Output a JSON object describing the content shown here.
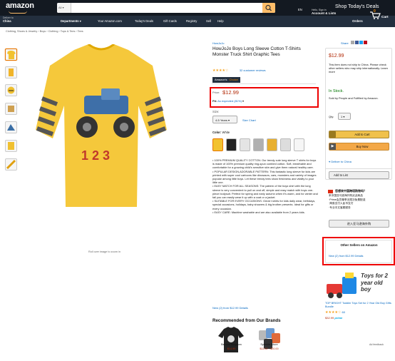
{
  "header": {
    "logo": "amazon",
    "search_category": "All",
    "promo": "Shop Today's Deals",
    "deliver_line1": "Deliver to",
    "deliver_line2": "China",
    "lang": "EN",
    "hello": "Hello, Sign in",
    "account": "Account & Lists",
    "orders": "Orders",
    "cart_count": "0",
    "cart": "Cart"
  },
  "nav": {
    "departments": "Departments",
    "items": [
      "Your Amazon.com",
      "Today's Deals",
      "Gift Cards",
      "Registry",
      "Sell",
      "Help"
    ]
  },
  "breadcrumb": "Clothing, Shoes & Jewelry › Boys › Clothing › Tops & Tees › Tees",
  "image": {
    "caption": "Roll over image to zoom in"
  },
  "product": {
    "brand": "HowJoJo",
    "title": "HowJoJo Boys Long Sleeve Cotton T-Shirts Monster Truck Shirt Graphic Tees",
    "reviews": "32 customer reviews",
    "badge_a": "Amazon's",
    "badge_b": "Choice",
    "price_label": "Price:",
    "price": "$12.99",
    "fit_label": "Fit:",
    "fit_value": "As expected (81%)",
    "size_label": "Size:",
    "size_value": "4-5 Years",
    "size_chart": "Size Chart",
    "color_label": "Color:",
    "color_value": "White",
    "bullets": [
      "100% PREMIUM QUALITY COTTON: Our trendy cute long sleeve T shirts for boys is made of 100% premium quality ring-spun combed cotton. Soft, breathable and comfortable for a growing child's sensitive skin and give them natural healthy care.",
      "POPULAR DESIGN,ADORABLE PATTERN: This fantastic long sleeve for kids are printed with super cool cartoons like dinosaurs, cars, monsters and variety of images popular among little boys. Let these trendy tees show freshness and vitality to your little one.",
      "EASY MATCH FOR ALL SEASONS: The pattern of the boys shirt with the long sleeve is very convenient to pull on and off, simple and easy match with boys one-piece bodysuit. Perfect for spring and early autumn when it's warm, and for winter and fall you can easily wear it up with a coat or a jacket.",
      "SUITABLE FOR EVERY OCCASIONS: Great t shirts for kids daily wear, birthdays, special occasions, holidays, baby showers & big brother presents. Ideal for gifts or every occasion.",
      "EASY CARE: Machine washable and are also available from 2 years kids."
    ],
    "new_offers": "New (2) from $12.99 Details"
  },
  "recommended": {
    "title": "Recommended from Our Brands",
    "items": [
      {
        "name": "Bevans Kingdom",
        "price": "$14.99"
      },
      {
        "name": "Sprinkle Allure",
        "price": "$11.82 - $20.00"
      }
    ]
  },
  "buybox": {
    "share": "Share",
    "price": "$12.99",
    "ship_note": "This item does not ship to China. Please check other sellers who may ship internationally. Learn more",
    "stock": "In Stock.",
    "sold_by": "Sold by People and Fulfilled by Amazon.",
    "qty_label": "Qty:",
    "qty_value": "1",
    "add_to_cart": "Add to Cart",
    "buy_now": "Buy Now",
    "deliver": "Deliver to China",
    "add_to_list": "Add to List",
    "cn_lines": [
      "您想来中国跨境购物吗？",
      "来中国亚马逊海外购买此商品",
      "·Prime会员尊享无限次免费配送",
      "·简易支付人民币支付",
      "·专业中文客服服务"
    ],
    "cn_button": "进入亚马逊海外购",
    "other_sellers_title": "Other Sellers on Amazon",
    "other_sellers_text": "New (2) from $12.99 Details"
  },
  "ad": {
    "headline": "Toys for 2 year old boy",
    "desc": "TOP BRIGHT Toddler Toys Set for 2 Year Old Boy Gifts Bundle",
    "rating": "60",
    "price": "$32.99",
    "prime": "prime",
    "label": "Ad feedback"
  },
  "colors": {
    "accent": "#febd69",
    "nav_dark": "#131921",
    "nav_mid": "#232f3e",
    "price_red": "#b12704",
    "link": "#0066c0",
    "stock_green": "#007600"
  }
}
